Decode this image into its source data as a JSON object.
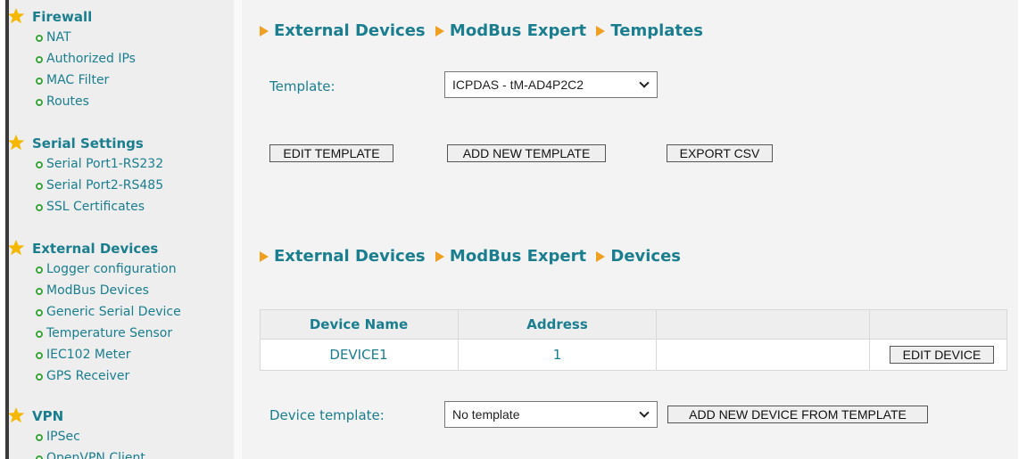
{
  "sidebar": {
    "sections": [
      {
        "title": "Firewall",
        "items": [
          "NAT",
          "Authorized IPs",
          "MAC Filter",
          "Routes"
        ]
      },
      {
        "title": "Serial Settings",
        "items": [
          "Serial Port1-RS232",
          "Serial Port2-RS485",
          "SSL Certificates"
        ]
      },
      {
        "title": "External Devices",
        "items": [
          "Logger configuration",
          "ModBus Devices",
          "Generic Serial Device",
          "Temperature Sensor",
          "IEC102 Meter",
          "GPS Receiver"
        ]
      },
      {
        "title": "VPN",
        "items": [
          "IPSec",
          "OpenVPN Client"
        ]
      }
    ]
  },
  "templates_section": {
    "breadcrumb": [
      "External Devices",
      "ModBus Expert",
      "Templates"
    ],
    "template_label": "Template:",
    "template_select_value": "ICPDAS - tM-AD4P2C2",
    "buttons": {
      "edit": "EDIT TEMPLATE",
      "add": "ADD NEW TEMPLATE",
      "export": "EXPORT CSV"
    }
  },
  "devices_section": {
    "breadcrumb": [
      "External Devices",
      "ModBus Expert",
      "Devices"
    ],
    "table": {
      "headers": [
        "Device Name",
        "Address",
        "",
        ""
      ],
      "rows": [
        {
          "name": "DEVICE1",
          "address": "1",
          "action": "EDIT DEVICE"
        }
      ]
    },
    "device_template_label": "Device template:",
    "device_template_select_value": "No template",
    "add_from_template_button": "ADD NEW DEVICE FROM TEMPLATE"
  },
  "colors": {
    "link": "#1a7e8e",
    "arrow": "#f0a020",
    "bullet": "#3aa53a",
    "star": "#f5b800"
  },
  "icons": {
    "section_icon": "star-icon",
    "item_icon": "bullet-circle-icon",
    "breadcrumb_separator": "triangle-right-icon"
  }
}
